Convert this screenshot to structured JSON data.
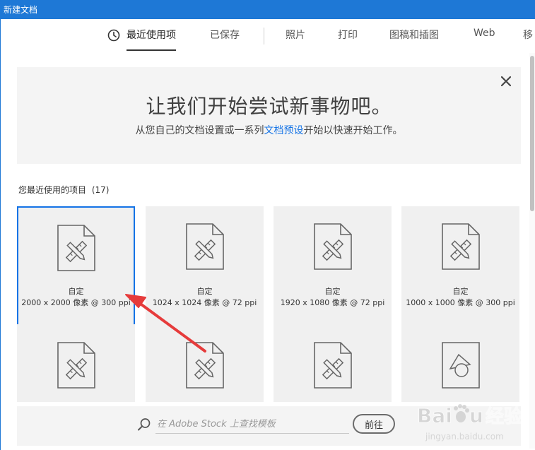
{
  "window": {
    "title": "新建文档"
  },
  "tabs": [
    {
      "label": "最近使用项",
      "active": true
    },
    {
      "label": "已保存"
    },
    {
      "label": "照片"
    },
    {
      "label": "打印"
    },
    {
      "label": "图稿和插图"
    },
    {
      "label": "Web"
    },
    {
      "label": "移"
    }
  ],
  "banner": {
    "title": "让我们开始尝试新事物吧。",
    "subtitle_before": "从您自己的文档设置或一系列",
    "subtitle_link": "文档预设",
    "subtitle_after": "开始以快速开始工作。"
  },
  "recent": {
    "label": "您最近使用的项目",
    "count": "(17)"
  },
  "cards": [
    {
      "name": "自定",
      "size": "2000 x 2000 像素 @ 300 ppi",
      "icon": "document-ruler-pencil-icon",
      "selected": true
    },
    {
      "name": "自定",
      "size": "1024 x 1024 像素 @ 72 ppi",
      "icon": "document-ruler-pencil-icon"
    },
    {
      "name": "自定",
      "size": "1920 x 1080 像素 @ 72 ppi",
      "icon": "document-ruler-pencil-icon"
    },
    {
      "name": "自定",
      "size": "1000 x 1000 像素 @ 300 ppi",
      "icon": "document-ruler-pencil-icon"
    },
    {
      "icon": "document-ruler-pencil-icon"
    },
    {
      "icon": "document-ruler-pencil-icon"
    },
    {
      "icon": "document-ruler-pencil-icon"
    },
    {
      "icon": "document-shapes-icon"
    }
  ],
  "search": {
    "placeholder": "在 Adobe Stock 上查找模板",
    "go_label": "前往"
  },
  "watermark": {
    "brand": "Bai",
    "brand_end": "u",
    "brand_cn": "经验",
    "url": "jingyan.baidu.com"
  },
  "colors": {
    "titlebar": "#1e78d6",
    "accent": "#1473e6",
    "arrow": "#e63b3b"
  }
}
